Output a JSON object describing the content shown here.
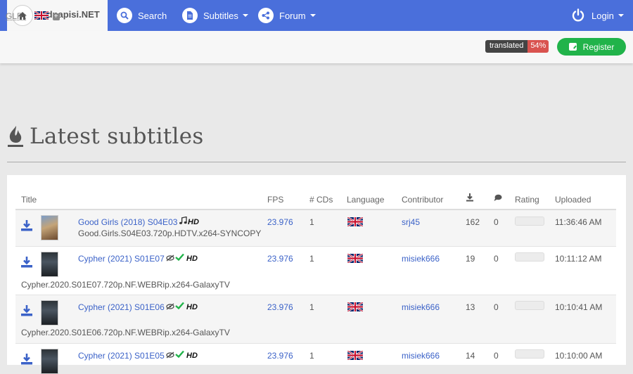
{
  "navbar": {
    "brand": "Podnapisi.NET",
    "search": "Search",
    "subtitles": "Subtitles",
    "forum": "Forum",
    "login": "Login"
  },
  "subbar": {
    "glf_label": "GLF :",
    "translated_label": "translated",
    "translated_pct": "54%",
    "register": "Register"
  },
  "page": {
    "title": "Latest subtitles"
  },
  "table": {
    "headers": {
      "title": "Title",
      "fps": "FPS",
      "cds": "# CDs",
      "language": "Language",
      "contributor": "Contributor",
      "rating": "Rating",
      "uploaded": "Uploaded"
    },
    "rows": [
      {
        "title": "Good Girls (2018) S04E03",
        "release": "Good.Girls.S04E03.720p.HDTV.x264-SYNCOPY",
        "fps": "23.976",
        "cds": "1",
        "contributor": "srj45",
        "downloads": "162",
        "comments": "0",
        "uploaded": "11:36:46 AM",
        "hd": "HD"
      },
      {
        "title": "Cypher (2021) S01E07",
        "release": "Cypher.2020.S01E07.720p.NF.WEBRip.x264-GalaxyTV",
        "fps": "23.976",
        "cds": "1",
        "contributor": "misiek666",
        "downloads": "19",
        "comments": "0",
        "uploaded": "10:11:12 AM",
        "hd": "HD"
      },
      {
        "title": "Cypher (2021) S01E06",
        "release": "Cypher.2020.S01E06.720p.NF.WEBRip.x264-GalaxyTV",
        "fps": "23.976",
        "cds": "1",
        "contributor": "misiek666",
        "downloads": "13",
        "comments": "0",
        "uploaded": "10:10:41 AM",
        "hd": "HD"
      },
      {
        "title": "Cypher (2021) S01E05",
        "release": "",
        "fps": "23.976",
        "cds": "1",
        "contributor": "misiek666",
        "downloads": "14",
        "comments": "0",
        "uploaded": "10:10:00 AM",
        "hd": "HD"
      }
    ]
  },
  "colors": {
    "navbar": "#4a6fdb",
    "link": "#3b62c8",
    "register": "#21b34a",
    "badge_red": "#d9534f"
  },
  "icons": [
    "home-icon",
    "search-icon",
    "document-icon",
    "share-icon",
    "power-icon",
    "flame-icon",
    "download-icon",
    "comment-icon",
    "music-icon",
    "hearing-impaired-icon",
    "check-icon",
    "uk-flag-icon"
  ]
}
